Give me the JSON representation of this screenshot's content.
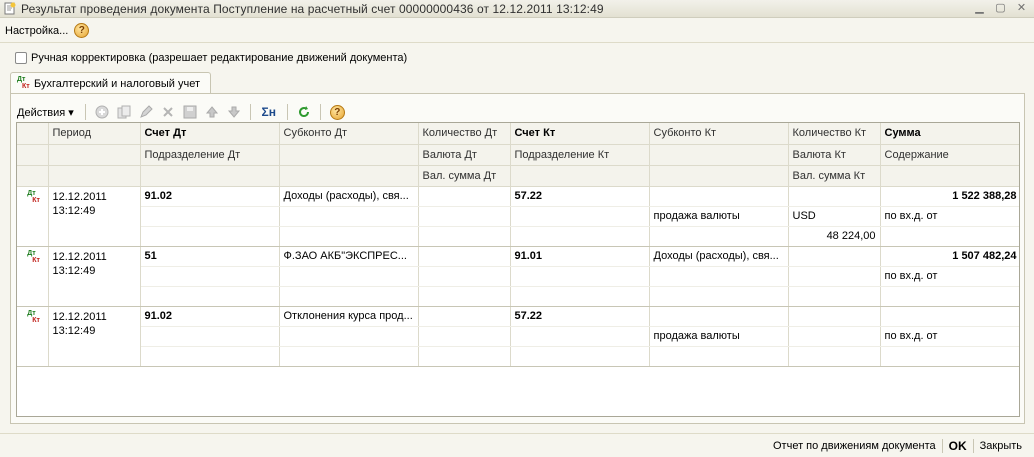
{
  "window": {
    "title": "Результат проведения документа Поступление на расчетный счет 00000000436 от 12.12.2011 13:12:49"
  },
  "menu": {
    "settings_label": "Настройка...",
    "help_label": "?"
  },
  "manual_correction": {
    "label": "Ручная корректировка (разрешает редактирование движений документа)",
    "checked": false
  },
  "tabs": [
    {
      "label": "Бухгалтерский и налоговый учет"
    }
  ],
  "toolbar": {
    "actions_label": "Действия ▾",
    "sum_label": "Σн",
    "help_label": "?"
  },
  "icon_labels": {
    "dt": "Дт",
    "kt": "Кт"
  },
  "columns": {
    "period": "Период",
    "account_dt": "Счет Дт",
    "subconto_dt": "Субконто Дт",
    "qty_dt": "Количество Дт",
    "account_kt": "Счет Кт",
    "subconto_kt": "Субконто Кт",
    "qty_kt": "Количество Кт",
    "amount": "Сумма",
    "dept_dt": "Подразделение Дт",
    "currency_dt": "Валюта Дт",
    "dept_kt": "Подразделение Кт",
    "currency_kt": "Валюта Кт",
    "content": "Содержание",
    "cur_amount_dt": "Вал. сумма Дт",
    "cur_amount_kt": "Вал. сумма Кт"
  },
  "rows": [
    {
      "date": "12.12.2011",
      "time": "13:12:49",
      "account_dt": "91.02",
      "subconto_dt": "Доходы (расходы), свя...",
      "account_kt": "57.22",
      "subconto_kt_1": "",
      "subconto_kt_2": "продажа валюты",
      "currency_kt": "USD",
      "cur_amount_kt": "48 224,00",
      "amount": "1 522 388,28",
      "content": "по вх.д. от"
    },
    {
      "date": "12.12.2011",
      "time": "13:12:49",
      "account_dt": "51",
      "subconto_dt": "Ф.ЗАО АКБ\"ЭКСПРЕС...",
      "account_kt": "91.01",
      "subconto_kt_1": "Доходы (расходы), свя...",
      "subconto_kt_2": "",
      "currency_kt": "",
      "cur_amount_kt": "",
      "amount": "1 507 482,24",
      "content": "по вх.д. от"
    },
    {
      "date": "12.12.2011",
      "time": "13:12:49",
      "account_dt": "91.02",
      "subconto_dt": "Отклонения курса прод...",
      "account_kt": "57.22",
      "subconto_kt_1": "",
      "subconto_kt_2": "продажа валюты",
      "currency_kt": "",
      "cur_amount_kt": "",
      "amount": "",
      "content": "по вх.д. от"
    }
  ],
  "status": {
    "report_label": "Отчет по движениям документа",
    "ok_label": "OK",
    "close_label": "Закрыть"
  }
}
